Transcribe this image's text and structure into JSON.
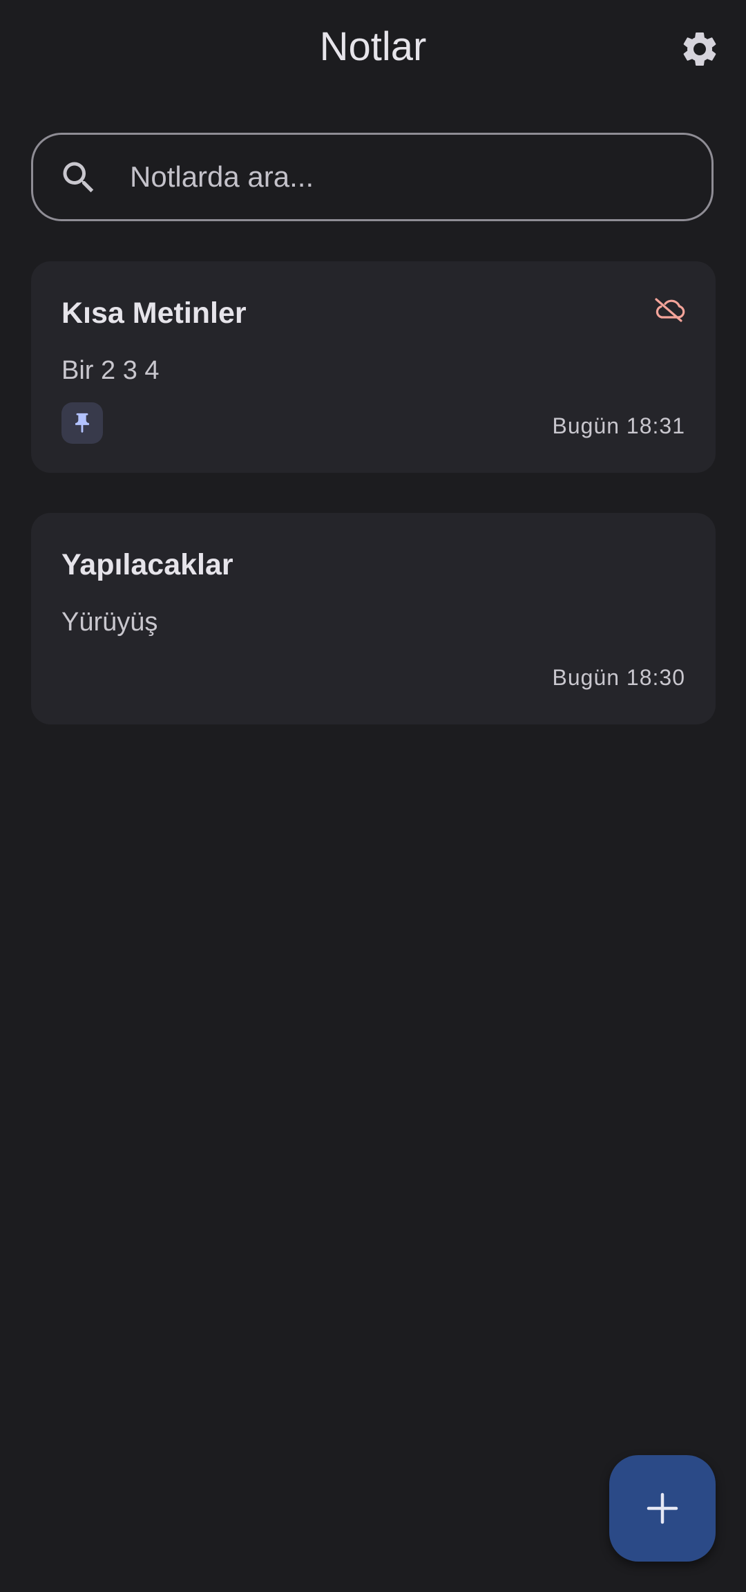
{
  "header": {
    "title": "Notlar",
    "settings_icon": "gear-icon"
  },
  "search": {
    "placeholder": "Notlarda ara...",
    "value": "",
    "icon": "search-icon"
  },
  "notes": [
    {
      "title": "Kısa Metinler",
      "body": "Bir 2 3 4",
      "date": "Bugün 18:31",
      "pinned": true,
      "sync_status_icon": "cloud-off-icon",
      "sync_status_color": "#f4a49a",
      "pin_color": "#b3c3ff"
    },
    {
      "title": "Yapılacaklar",
      "body": "Yürüyüş",
      "date": "Bugün 18:30",
      "pinned": false
    }
  ],
  "fab": {
    "icon": "plus-icon",
    "color": "#2b4a87"
  },
  "colors": {
    "background": "#1c1c1f",
    "card": "#25252a",
    "text_primary": "#e6e4ea",
    "text_secondary": "#c9c7ce"
  }
}
